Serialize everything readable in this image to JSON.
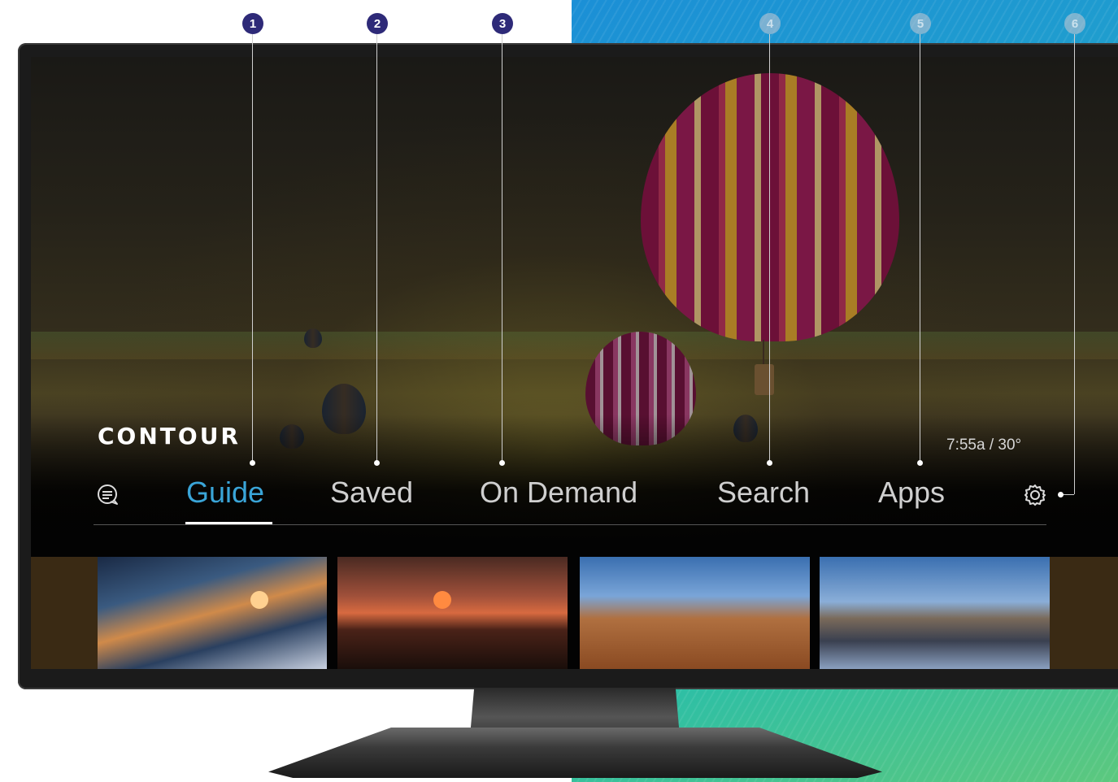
{
  "brand": {
    "logo_text": "CONTOUR"
  },
  "status": {
    "time_weather": "7:55a / 30°"
  },
  "nav": {
    "items": [
      {
        "label": "Guide",
        "active": true
      },
      {
        "label": "Saved",
        "active": false
      },
      {
        "label": "On Demand",
        "active": false
      },
      {
        "label": "Search",
        "active": false
      },
      {
        "label": "Apps",
        "active": false
      }
    ],
    "left_icon": "chat-bubble-icon",
    "right_icon": "gear-icon",
    "active_color": "#3aa5d8"
  },
  "callouts": [
    {
      "number": "1"
    },
    {
      "number": "2"
    },
    {
      "number": "3"
    },
    {
      "number": "4"
    },
    {
      "number": "5"
    },
    {
      "number": "6"
    }
  ],
  "tiles": [
    {
      "name": "sailboat"
    },
    {
      "name": "beach-chairs-sunset"
    },
    {
      "name": "colosseum"
    },
    {
      "name": "city-skyline-river"
    }
  ],
  "colors": {
    "badge": "#2e2a78",
    "accent_gradient_start": "#1b8fd6",
    "accent_gradient_end": "#5cc87e"
  }
}
